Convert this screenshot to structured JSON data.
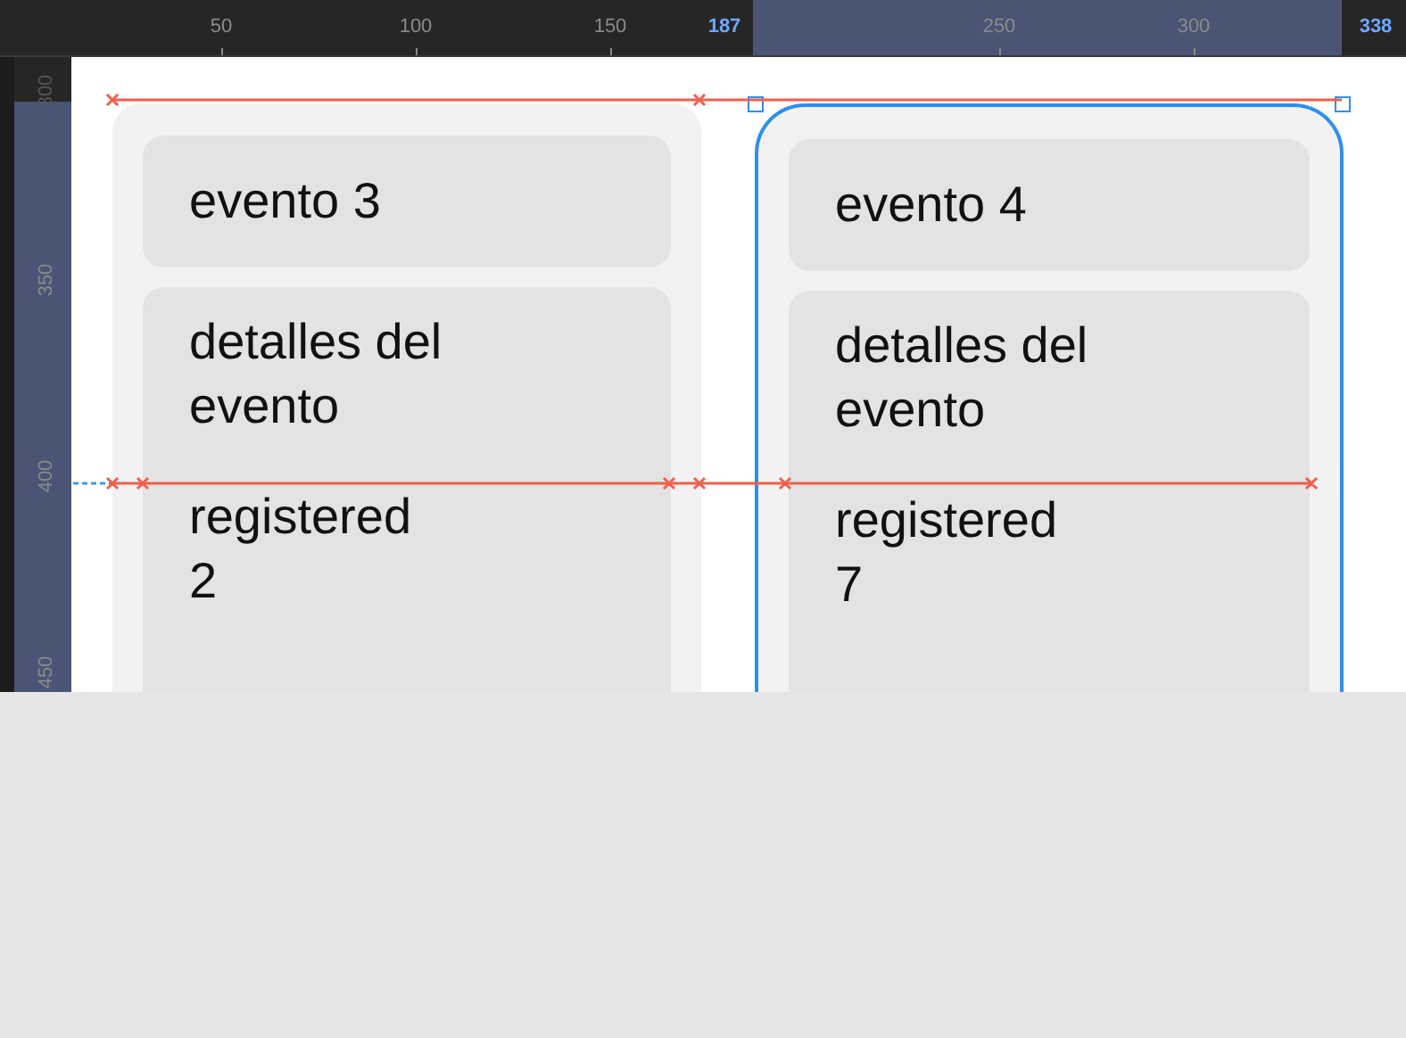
{
  "top_ruler": {
    "ticks": [
      {
        "label": "50",
        "selected": false
      },
      {
        "label": "100",
        "selected": false
      },
      {
        "label": "150",
        "selected": false
      },
      {
        "label": "187",
        "selected": true
      },
      {
        "label": "250",
        "selected": false
      },
      {
        "label": "300",
        "selected": false
      },
      {
        "label": "338",
        "selected": true
      }
    ]
  },
  "left_ruler": {
    "ticks": [
      "300",
      "350",
      "400",
      "450"
    ]
  },
  "cards": [
    {
      "title": "evento 3",
      "details": "detalles del evento",
      "registered_label": "registered",
      "count": "2",
      "selected": false
    },
    {
      "title": "evento 4",
      "details": "detalles del evento",
      "registered_label": "registered",
      "count": "7",
      "selected": true
    }
  ]
}
